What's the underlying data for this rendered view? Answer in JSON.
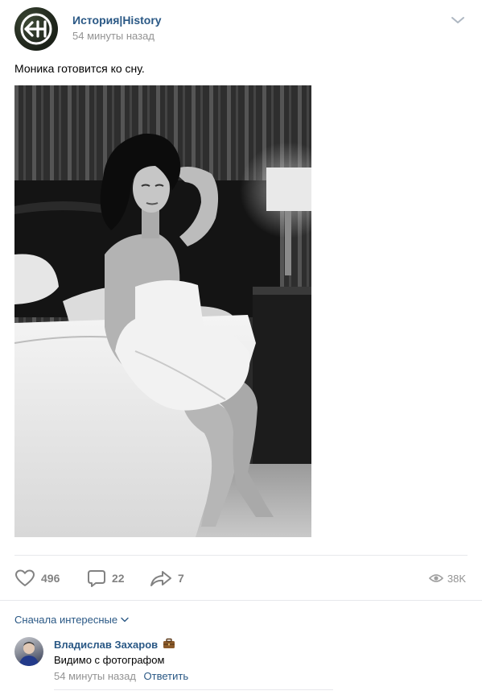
{
  "post": {
    "author": "История|History",
    "time": "54 минуты назад",
    "text": "Моника готовится ко сну.",
    "photo_alt": "black-and-white photo"
  },
  "actions": {
    "likes": "496",
    "comments": "22",
    "shares": "7",
    "views": "38K"
  },
  "comments_section": {
    "sort_label": "Сначала интересные",
    "items": [
      {
        "author": "Владислав Захаров",
        "text": "Видимо с фотографом",
        "time": "54 минуты назад",
        "reply_label": "Ответить"
      }
    ]
  },
  "colors": {
    "link": "#2a5885",
    "muted": "#939393",
    "icon": "#828282",
    "divider": "#e7e8ec"
  },
  "icons": [
    "more-chevron-icon",
    "heart-icon",
    "comment-icon",
    "share-icon",
    "eye-icon",
    "briefcase-icon",
    "chevron-down-icon"
  ]
}
